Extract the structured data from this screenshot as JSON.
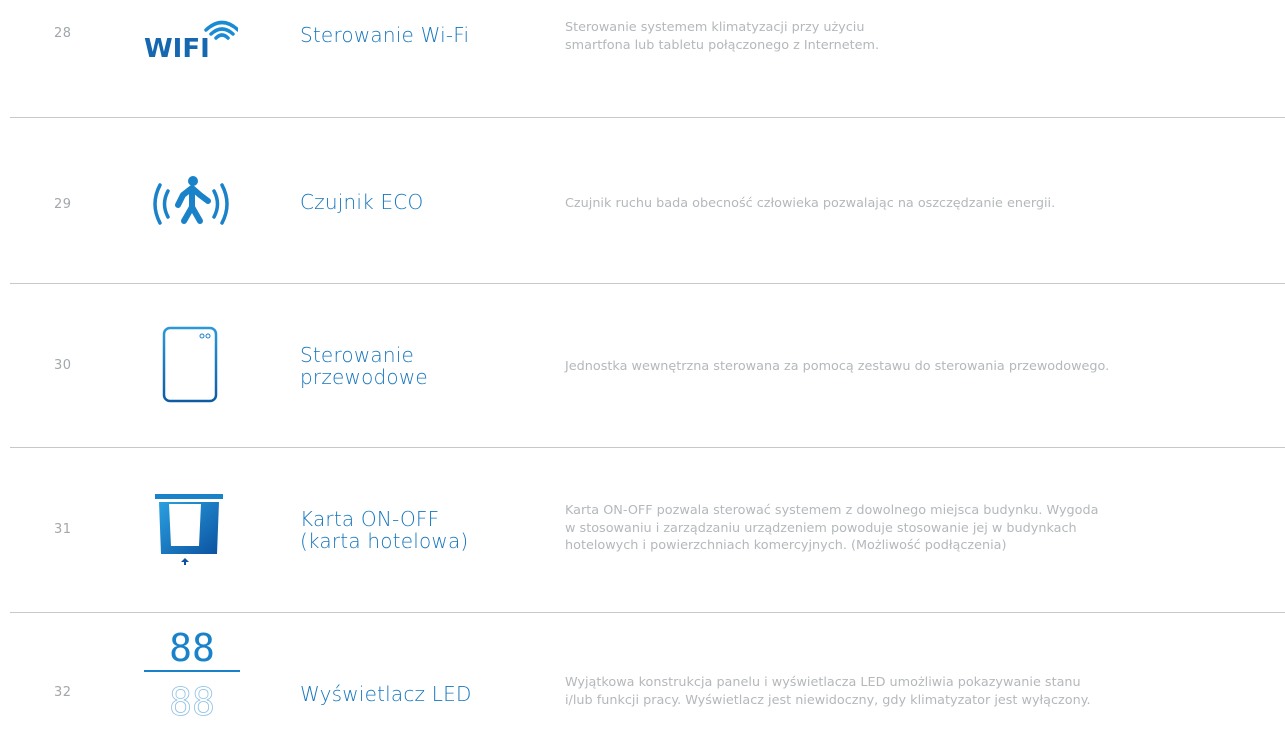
{
  "rows": [
    {
      "number": "28",
      "icon": "wifi-icon",
      "title": "Sterowanie Wi-Fi",
      "description": "Sterowanie systemem klimatyzacji przy użyciu\nsmartfona lub tabletu połączonego z Internetem."
    },
    {
      "number": "29",
      "icon": "motion-sensor-icon",
      "title": "Czujnik ECO",
      "description": "Czujnik ruchu bada obecność człowieka pozwalając na oszczędzanie energii."
    },
    {
      "number": "30",
      "icon": "wired-controller-icon",
      "title": "Sterowanie\nprzewodowe",
      "description": "Jednostka wewnętrzna sterowana za pomocą zestawu do sterowania przewodowego."
    },
    {
      "number": "31",
      "icon": "card-slot-icon",
      "title": "Karta ON-OFF\n(karta hotelowa)",
      "description": "Karta ON-OFF pozwala sterować systemem z dowolnego miejsca budynku. Wygoda\nw stosowaniu i zarządzaniu urządzeniem powoduje stosowanie jej w budynkach\nhotelowych i powierzchniach komercyjnych. (Możliwość podłączenia)"
    },
    {
      "number": "32",
      "icon": "led-display-icon",
      "title": "Wyświetlacz LED",
      "description": "Wyjątkowa konstrukcja panelu i wyświetlacza LED umożliwia pokazywanie stanu\ni/lub funkcji pracy. Wyświetlacz jest niewidoczny, gdy klimatyzator jest wyłączony."
    }
  ],
  "icon_text": {
    "wifi_word": "WIFI",
    "led_digits": "88"
  },
  "colors": {
    "accent": "#1676bd",
    "icon_blue": "#1a7fc6",
    "number_gray": "#a2a7ab",
    "description_gray": "#b4b8bb",
    "divider": "#c6c9cb"
  }
}
